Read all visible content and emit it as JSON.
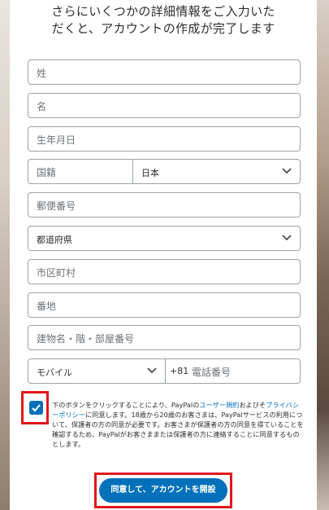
{
  "heading": {
    "line1": "さらにいくつかの詳細情報をご入力いた",
    "line2": "だくと、アカウントの作成が完了します"
  },
  "fields": {
    "last_name": "姓",
    "first_name": "名",
    "birthdate": "生年月日",
    "nationality_placeholder": "国籍",
    "country_value": "日本",
    "postal_code": "郵便番号",
    "prefecture": "都道府県",
    "city": "市区町村",
    "address": "番地",
    "building": "建物名・階・部屋番号",
    "phone_type": "モバイル",
    "phone_prefix": "+81",
    "phone_number": "電話番号"
  },
  "consent": {
    "checked": true,
    "text_before": "下のボタンをクリックすることにより、PayPalの",
    "link_user_agreement": "ユーザー規約",
    "text_and": "およびそ",
    "link_privacy": "プライバシーポリシー",
    "text_rest": "に同意します。18歳から20歳のお客さまは、PayPalサービスの利用について、保護者の方の同意が必要です。お客さまが保護者の方の同意を得ていることを確認するため、PayPalがお客さままたは保護者の方に連絡することに同意するものとします。"
  },
  "submit": {
    "label": "同意して、アカウントを開設"
  },
  "colors": {
    "accent": "#0070ba",
    "highlight": "#e0161b",
    "border": "#9aa3a8"
  }
}
